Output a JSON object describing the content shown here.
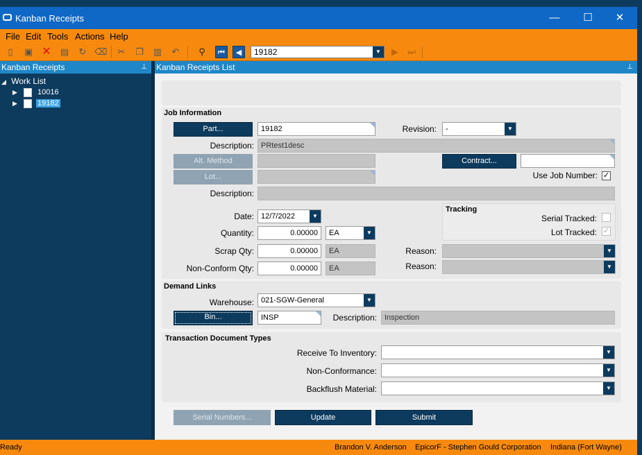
{
  "window": {
    "title": "Kanban Receipts",
    "minimize": "—",
    "maximize": "☐",
    "close": "✕"
  },
  "menu": [
    "File",
    "Edit",
    "Tools",
    "Actions",
    "Help"
  ],
  "toolbar": {
    "record_value": "19182"
  },
  "left_pane": {
    "header": "Kanban Receipts",
    "root": "Work List",
    "items": [
      {
        "label": "10016",
        "selected": false
      },
      {
        "label": "19182",
        "selected": true
      }
    ]
  },
  "right_pane": {
    "header": "Kanban Receipts List"
  },
  "job": {
    "title": "Job Information",
    "part_button": "Part...",
    "part_value": "19182",
    "revision_label": "Revision:",
    "revision_value": "-",
    "description_label": "Description:",
    "description_value": "PRtest1desc",
    "alt_method_button": "Alt. Method",
    "contract_button": "Contract...",
    "lot_button": "Lot...",
    "use_job_label": "Use Job Number:",
    "use_job_checked": "✓",
    "description2_label": "Description:",
    "date_label": "Date:",
    "date_value": "12/7/2022",
    "quantity_label": "Quantity:",
    "quantity_value": "0.00000",
    "quantity_uom": "EA",
    "scrap_label": "Scrap Qty:",
    "scrap_value": "0.00000",
    "scrap_uom": "EA",
    "nonconform_label": "Non-Conform Qty:",
    "nonconform_value": "0.00000",
    "nonconform_uom": "EA",
    "reason_label": "Reason:",
    "reason2_label": "Reason:",
    "tracking_title": "Tracking",
    "serial_tracked_label": "Serial Tracked:",
    "lot_tracked_label": "Lot Tracked:",
    "lot_tracked_checked": "✓"
  },
  "demand": {
    "title": "Demand Links",
    "warehouse_label": "Warehouse:",
    "warehouse_value": "021-SGW-General",
    "bin_button": "Bin...",
    "bin_value": "INSP",
    "description_label": "Description:",
    "description_value": "Inspection"
  },
  "transaction": {
    "title": "Transaction Document Types",
    "receive_label": "Receive To Inventory:",
    "nonconf_label": "Non-Conformance:",
    "backflush_label": "Backflush Material:"
  },
  "buttons": {
    "serial": "Serial Numbers...",
    "update": "Update",
    "submit": "Submit"
  },
  "status": {
    "left": "Ready",
    "user": "Brandon V. Anderson",
    "company": "EpicorF - Stephen Gould Corporation",
    "site": "Indiana (Fort Wayne)"
  }
}
